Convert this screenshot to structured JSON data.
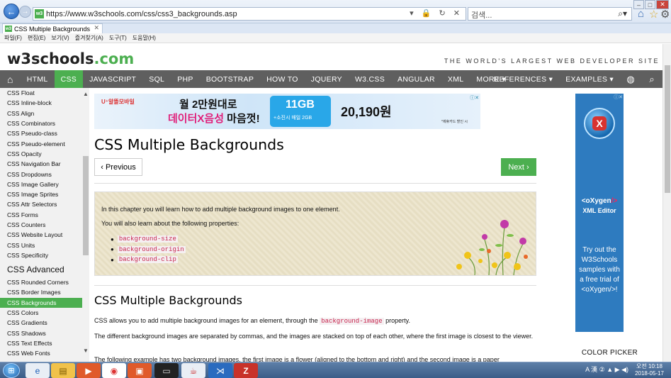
{
  "browser": {
    "url": "https://www.w3schools.com/css/css3_backgrounds.asp",
    "search_placeholder": "검색...",
    "tab_title": "CSS Multiple Backgrounds",
    "menu": [
      "파일(F)",
      "편집(E)",
      "보기(V)",
      "즐겨찾기(A)",
      "도구(T)",
      "도움말(H)"
    ]
  },
  "header": {
    "logo_main": "w3schools",
    "logo_tld": ".com",
    "tagline": "THE WORLD'S LARGEST WEB DEVELOPER SITE"
  },
  "topnav": {
    "items": [
      "HTML",
      "CSS",
      "JAVASCRIPT",
      "SQL",
      "PHP",
      "BOOTSTRAP",
      "HOW TO",
      "JQUERY",
      "W3.CSS",
      "ANGULAR",
      "XML",
      "MORE ▾"
    ],
    "right": [
      "REFERENCES ▾",
      "EXAMPLES ▾"
    ],
    "active_color": "#4caf50",
    "bar_color": "#5f5f5f"
  },
  "sidebar": {
    "links_top": [
      "CSS Float",
      "CSS Inline-block",
      "CSS Align",
      "CSS Combinators",
      "CSS Pseudo-class",
      "CSS Pseudo-element",
      "CSS Opacity",
      "CSS Navigation Bar",
      "CSS Dropdowns",
      "CSS Image Gallery",
      "CSS Image Sprites",
      "CSS Attr Selectors",
      "CSS Forms",
      "CSS Counters",
      "CSS Website Layout",
      "CSS Units",
      "CSS Specificity"
    ],
    "heading": "CSS Advanced",
    "links_advanced": [
      "CSS Rounded Corners",
      "CSS Border Images",
      "CSS Backgrounds",
      "CSS Colors",
      "CSS Gradients",
      "CSS Shadows",
      "CSS Text Effects",
      "CSS Web Fonts"
    ],
    "active": "CSS Backgrounds"
  },
  "ad": {
    "brand": "U⁺알뜰모바일",
    "line1": "월 2만원대로",
    "line2_a": "데이터X음성",
    "line2_b": " 마음껏!",
    "box_big": "11GB",
    "box_small": "+소진시 매일 2GB",
    "price": "20,190원",
    "note": "*제휴카드 할인 시"
  },
  "main": {
    "title": "CSS Multiple Backgrounds",
    "prev_label": "Previous",
    "next_label": "Next",
    "intro_p1": "In this chapter you will learn how to add multiple background images to one element.",
    "intro_p2": "You will also learn about the following properties:",
    "properties": [
      "background-size",
      "background-origin",
      "background-clip"
    ],
    "section_title": "CSS Multiple Backgrounds",
    "para1_a": "CSS allows you to add multiple background images for an element, through the ",
    "para1_code": "background-image",
    "para1_b": " property.",
    "para2": "The different background images are separated by commas, and the images are stacked on top of each other, where the first image is closest to the viewer.",
    "para3": "The following example has two background images, the first image is a flower (aligned to the bottom and right) and the second image is a paper"
  },
  "right_ad": {
    "brand_a": "<oXygen",
    "brand_b": "/>",
    "product": "XML Editor",
    "copy": "Try out the W3Schools samples with a free trial of <oXygen/>!"
  },
  "right": {
    "color_picker": "COLOR PICKER"
  },
  "taskbar": {
    "tray": "A 漢 ② ▲ ▶ ◀)",
    "time": "오전 10:18",
    "date": "2018-05-17"
  }
}
